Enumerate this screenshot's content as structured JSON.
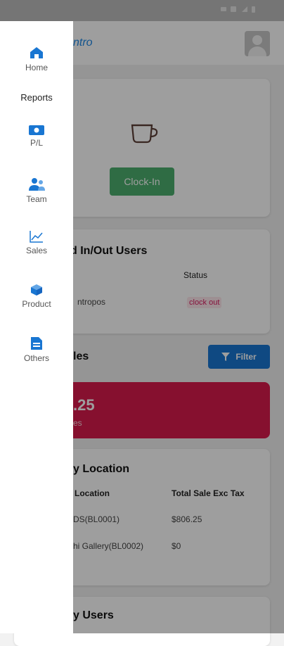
{
  "colors": {
    "primary": "#1976d2",
    "success": "#4caf6e",
    "danger": "#d81b4d",
    "drawer": "#ffffff"
  },
  "app": {
    "logo_text": "ntro"
  },
  "clock": {
    "button_label": "Clock-In",
    "icon": "coffee-cup-icon"
  },
  "users_panel": {
    "title": "d In/Out Users",
    "status_header": "Status",
    "user_name": "ntropos",
    "user_status": "clock out"
  },
  "sales": {
    "title": "les",
    "filter_label": "Filter",
    "value": ".25",
    "subtitle": "es"
  },
  "location_panel": {
    "title": "y Location",
    "col_location": "Location",
    "col_total": "Total Sale Exc Tax",
    "rows": [
      {
        "location": "DS(BL0001)",
        "total": "$806.25"
      },
      {
        "location": "hi Gallery(BL0002)",
        "total": "$0"
      }
    ]
  },
  "users_section": {
    "title": "y Users"
  },
  "drawer": {
    "items": [
      {
        "label": "Home",
        "icon": "home-icon"
      },
      {
        "label": "Reports"
      },
      {
        "label": "P/L",
        "icon": "money-icon"
      },
      {
        "label": "Team",
        "icon": "team-icon"
      },
      {
        "label": "Sales",
        "icon": "chart-icon"
      },
      {
        "label": "Product",
        "icon": "cube-icon"
      },
      {
        "label": "Others",
        "icon": "document-icon"
      }
    ]
  }
}
